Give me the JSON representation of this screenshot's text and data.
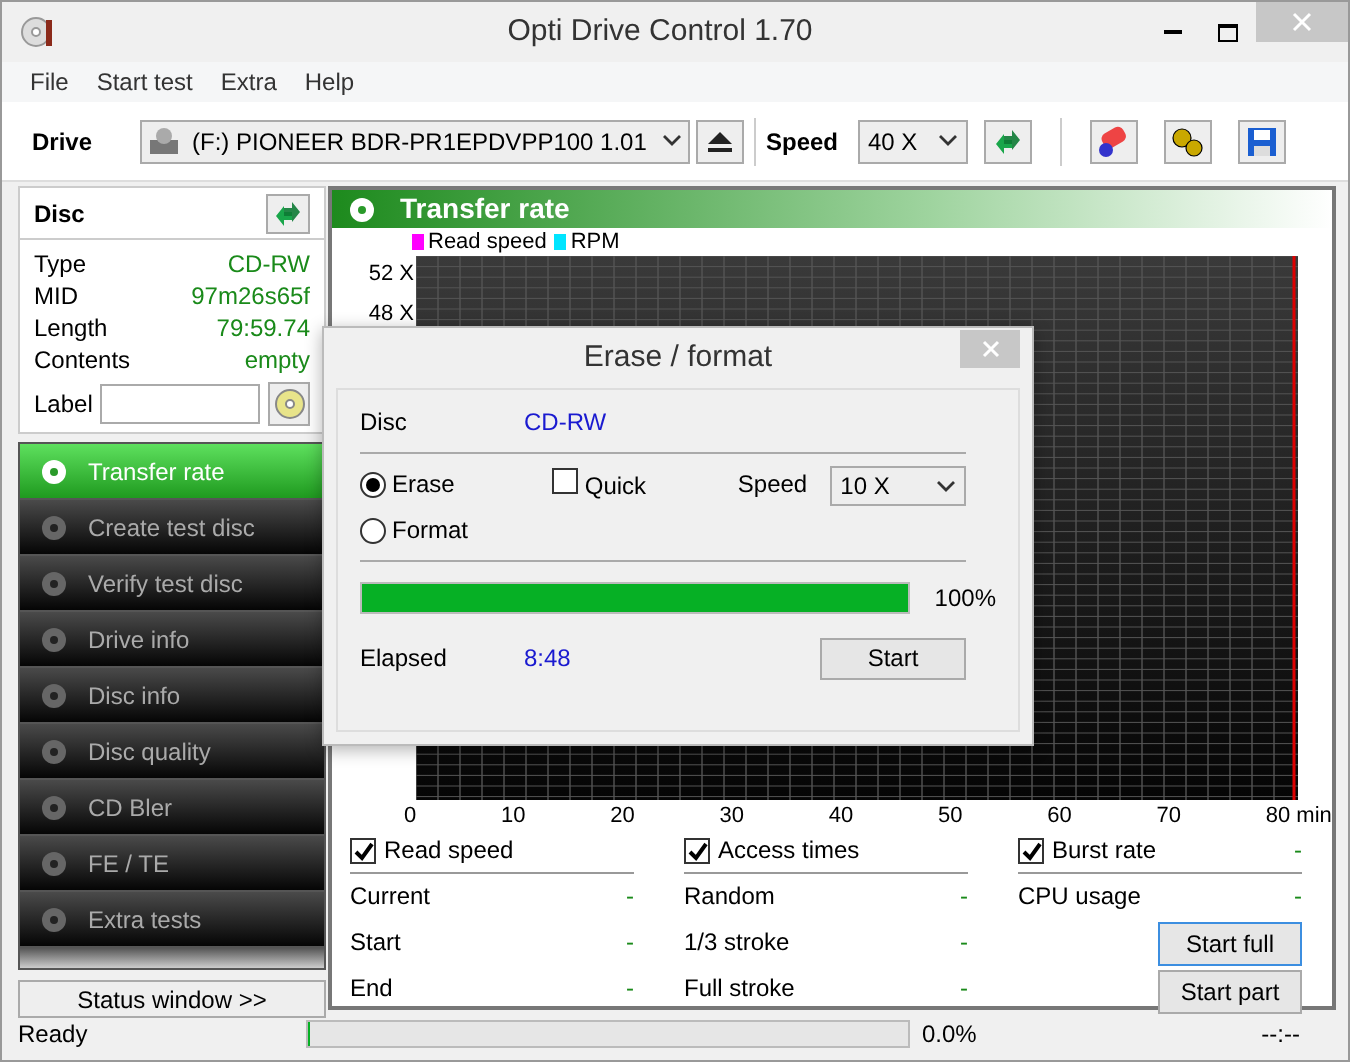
{
  "window": {
    "title": "Opti Drive Control 1.70"
  },
  "menu": [
    "File",
    "Start test",
    "Extra",
    "Help"
  ],
  "toolbar": {
    "drive_label": "Drive",
    "drive_value": "(F:)   PIONEER BDR-PR1EPDVPP100 1.01",
    "speed_label": "Speed",
    "speed_value": "40 X"
  },
  "disc": {
    "title": "Disc",
    "fields": [
      {
        "label": "Type",
        "value": "CD-RW"
      },
      {
        "label": "MID",
        "value": "97m26s65f"
      },
      {
        "label": "Length",
        "value": "79:59.74"
      },
      {
        "label": "Contents",
        "value": "empty"
      }
    ],
    "label_field": "Label"
  },
  "nav": [
    {
      "label": "Transfer rate",
      "selected": true
    },
    {
      "label": "Create test disc",
      "selected": false
    },
    {
      "label": "Verify test disc",
      "selected": false
    },
    {
      "label": "Drive info",
      "selected": false
    },
    {
      "label": "Disc info",
      "selected": false
    },
    {
      "label": "Disc quality",
      "selected": false
    },
    {
      "label": "CD Bler",
      "selected": false
    },
    {
      "label": "FE / TE",
      "selected": false
    },
    {
      "label": "Extra tests",
      "selected": false
    }
  ],
  "status_window_button": "Status window >>",
  "panel": {
    "title": "Transfer rate",
    "legend": [
      {
        "label": "Read speed",
        "color": "#ff00ff"
      },
      {
        "label": "RPM",
        "color": "#00e5ff"
      }
    ],
    "y_ticks": [
      "52 X",
      "48 X"
    ],
    "x_ticks": [
      "0",
      "10",
      "20",
      "30",
      "40",
      "50",
      "60",
      "70",
      "80 min"
    ]
  },
  "stats": [
    {
      "label": "Read speed",
      "checked": true,
      "rows": [
        {
          "label": "Current",
          "value": "-"
        },
        {
          "label": "Start",
          "value": "-"
        },
        {
          "label": "End",
          "value": "-"
        }
      ]
    },
    {
      "label": "Access times",
      "checked": true,
      "rows": [
        {
          "label": "Random",
          "value": "-"
        },
        {
          "label": "1/3 stroke",
          "value": "-"
        },
        {
          "label": "Full stroke",
          "value": "-"
        }
      ]
    },
    {
      "label": "Burst rate",
      "checked": true,
      "value": "-",
      "rows": [
        {
          "label": "CPU usage",
          "value": "-"
        }
      ]
    }
  ],
  "buttons": [
    "Start full",
    "Start part"
  ],
  "status_bar": {
    "text": "Ready",
    "level": 0,
    "percent": "0.0%",
    "time": "--:--"
  },
  "dialog": {
    "title": "Erase / format",
    "disc_label": "Disc",
    "disc_value": "CD-RW",
    "modes": [
      {
        "label": "Erase",
        "selected": true
      },
      {
        "label": "Format",
        "selected": false
      }
    ],
    "quick": {
      "label": "Quick",
      "checked": false
    },
    "speed_label": "Speed",
    "speed_value": "10 X",
    "progress": {
      "level": 1,
      "reading": "100%"
    },
    "elapsed_label": "Elapsed",
    "elapsed_value": "8:48",
    "start_button": "Start"
  }
}
